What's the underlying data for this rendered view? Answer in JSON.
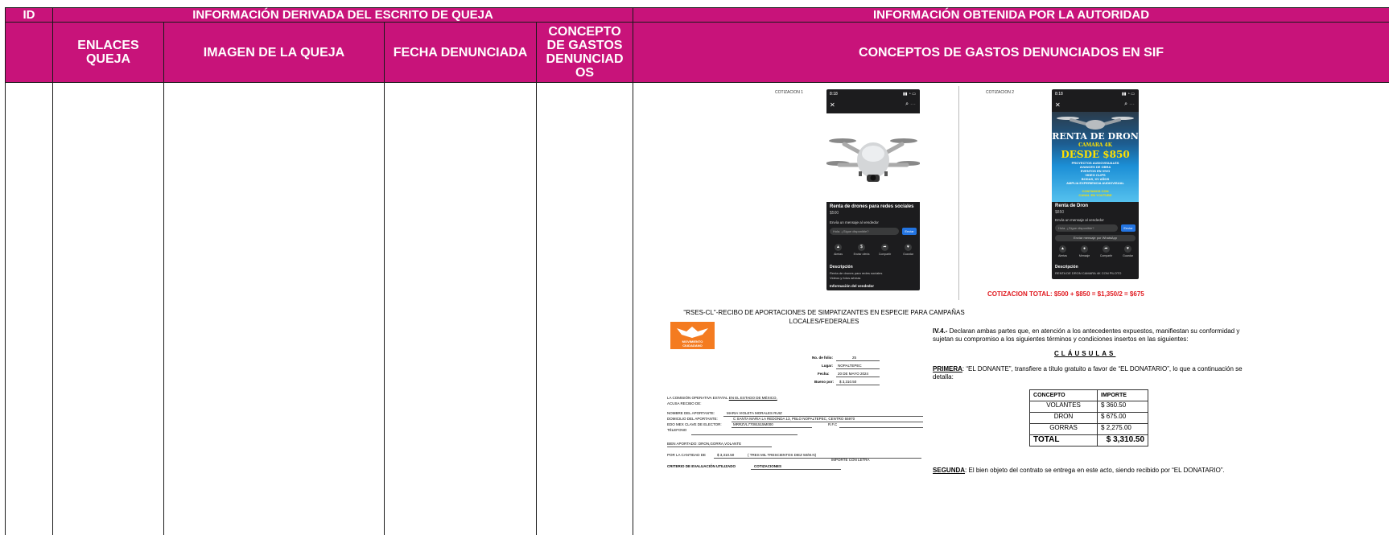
{
  "header": {
    "id": "ID",
    "group_queja": "INFORMACIÓN DERIVADA DEL ESCRITO DE QUEJA",
    "group_autoridad": "INFORMACIÓN OBTENIDA POR LA AUTORIDAD",
    "col_enlaces": "ENLACES QUEJA",
    "col_imagen": "IMAGEN DE LA QUEJA",
    "col_fecha": "FECHA DENUNCIADA",
    "col_concepto": "CONCEPTO DE GASTOS DENUNCIAD OS",
    "col_sif": "CONCEPTOS DE GASTOS DENUNCIADOS EN SIF"
  },
  "colors": {
    "header_bg": "#c8137a",
    "header_text": "#ffffff",
    "total_red": "#e0191f",
    "logo_orange": "#f47b20"
  },
  "quote1": {
    "label": "COTIZACION 1",
    "time": "8:18",
    "title": "Renta de drones para redes sociales",
    "price": "$500",
    "msg_label": "Envía un mensaje al vendedor",
    "msg_placeholder": "Hola. ¿Sigue disponible?",
    "send": "Enviar",
    "actions": [
      "Alertas",
      "Enviar oferta",
      "Compartir",
      "Guardar"
    ],
    "desc_heading": "Descripción",
    "desc_lines": [
      "Renta de drones para redes sociales",
      "Videos y fotos aéreas"
    ],
    "footer": "Información del vendedor"
  },
  "quote2": {
    "label": "COTIZACION 2",
    "time": "8:18",
    "poster_title": "RENTA DE DRON",
    "poster_sub": "CAMARA 4K",
    "poster_price": "DESDE $850",
    "poster_lines": [
      "PROYECTOS AUDIOVISUALES",
      "AVANCES DE OBRA",
      "EVENTOS EN VIVO",
      "VIDEO CLIPS",
      "BODAS, XV AÑOS",
      "AMPLIA EXPERIENCIA AUDIOVISUAL",
      "CONTAMOS CON",
      "CANAL EN YOUTUBE"
    ],
    "title": "Renta de Dron",
    "price": "$850",
    "msg_label": "Envía un mensaje al vendedor",
    "msg_placeholder": "Hola. ¿Sigue disponible?",
    "send": "Enviar",
    "whatsapp": "Enviar mensaje por WhatsApp",
    "actions": [
      "Alertas",
      "Mensaje",
      "Compartir",
      "Guardar"
    ],
    "desc_heading": "Descripción",
    "desc_lines": [
      "RENTA DE DRON CAMARA 4K CON PILOTO"
    ]
  },
  "quote_total": "COTIZACION TOTAL: $500 + $850 = $1,350/2 = $675",
  "receipt": {
    "title": "\"RSES-CL\"-RECIBO DE APORTACIONES DE SIMPATIZANTES EN ESPECIE PARA CAMPAÑAS LOCALES/FEDERALES",
    "logo_text1": "MOVIMIENTO",
    "logo_text2": "CIUDADANO",
    "folio_label": "No. de folio:",
    "folio": "25",
    "lugar_label": "Lugar:",
    "lugar": "NOPALTEPEC",
    "fecha_label": "Fecha:",
    "fecha": "20 DE MAYO 2024",
    "bueno_label": "Bueno por:",
    "bueno": "$ 3,310.50",
    "comision": "LA COMISIÓN OPERATIVA ESTATAL",
    "comision_u": "EN EL ESTADO DE MÉXICO,",
    "acusa": "ACUSA RECIBO DE:",
    "nombre_label": "NOMBRE DEL APORTANTE:",
    "nombre": "MARIA VIOLETA MORALES RUIZ",
    "domicilio_label": "DOMICILIO DEL APORTANTE:",
    "domicilio": "C SANTA MARIA LA REDONDA 13, PBLO NOPALTEPEC, CENTRO 55970",
    "edo": "EDO MEX CLAVE DE ELECTOR:",
    "clave": "MRRZVL77091515M000",
    "rfc": "R.F.C",
    "telefono": "TÉLEFONO",
    "bien": "BIEN APORTADO: DRON,GORRA,VOLANTE",
    "cantidad_label": "POR LA CANTIDAD DE",
    "cantidad": "$ 3,310.50",
    "letra": "( TRES MIL TRESCIENTOS DIEZ 50/M.N)",
    "importe_letra": "IMPORTE CON LETRA",
    "criterio_label": "CRITERIO DE EVALUACIÓN UTILIZADO",
    "criterio": "COTIZACIONES"
  },
  "contract": {
    "iv_num": "IV.4.-",
    "iv_text": "Declaran ambas partes que, en atención a los antecedentes expuestos, manifiestan su conformidad y sujetan su compromiso a los siguientes términos y condiciones insertos en las siguientes:",
    "clausulas": "CLÁUSULAS",
    "primera_label": "PRIMERA",
    "primera_a": ": “EL DONANTE”, transfiere a título gratuito a favor de “EL DONATARIO”, lo que a continuación se detalla:",
    "segunda_label": "SEGUNDA",
    "segunda_a": ": El bien objeto del contrato se entrega en este acto, siendo recibido por “EL DONATARIO”.",
    "table_headers": [
      "CONCEPTO",
      "IMPORTE"
    ],
    "rows": [
      {
        "concepto": "VOLANTES",
        "importe": "$   360.50"
      },
      {
        "concepto": "DRON",
        "importe": "$  675.00"
      },
      {
        "concepto": "GORRAS",
        "importe": "$ 2,275.00"
      }
    ],
    "total_label": "TOTAL",
    "total": "$ 3,310.50"
  }
}
